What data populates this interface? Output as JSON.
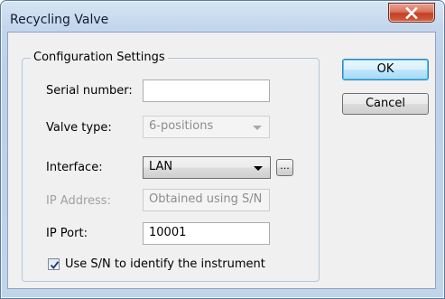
{
  "window": {
    "title": "Recycling Valve",
    "close_icon": "close-icon"
  },
  "group": {
    "title": "Configuration Settings"
  },
  "fields": {
    "serial_number": {
      "label": "Serial number:",
      "value": ""
    },
    "valve_type": {
      "label": "Valve type:",
      "value": "6-positions",
      "enabled": false
    },
    "interface": {
      "label": "Interface:",
      "value": "LAN",
      "enabled": true,
      "browse_label": "..."
    },
    "ip_address": {
      "label": "IP Address:",
      "value": "Obtained using S/N",
      "enabled": false
    },
    "ip_port": {
      "label": "IP Port:",
      "value": "10001"
    }
  },
  "checkbox": {
    "label": "Use S/N to identify the instrument",
    "checked": true
  },
  "buttons": {
    "ok": "OK",
    "cancel": "Cancel"
  },
  "colors": {
    "title_bar": "#c3d6ec",
    "close_button": "#c33f27",
    "dialog_body": "#f0f0f0",
    "default_button_border": "#3c7fb1"
  }
}
